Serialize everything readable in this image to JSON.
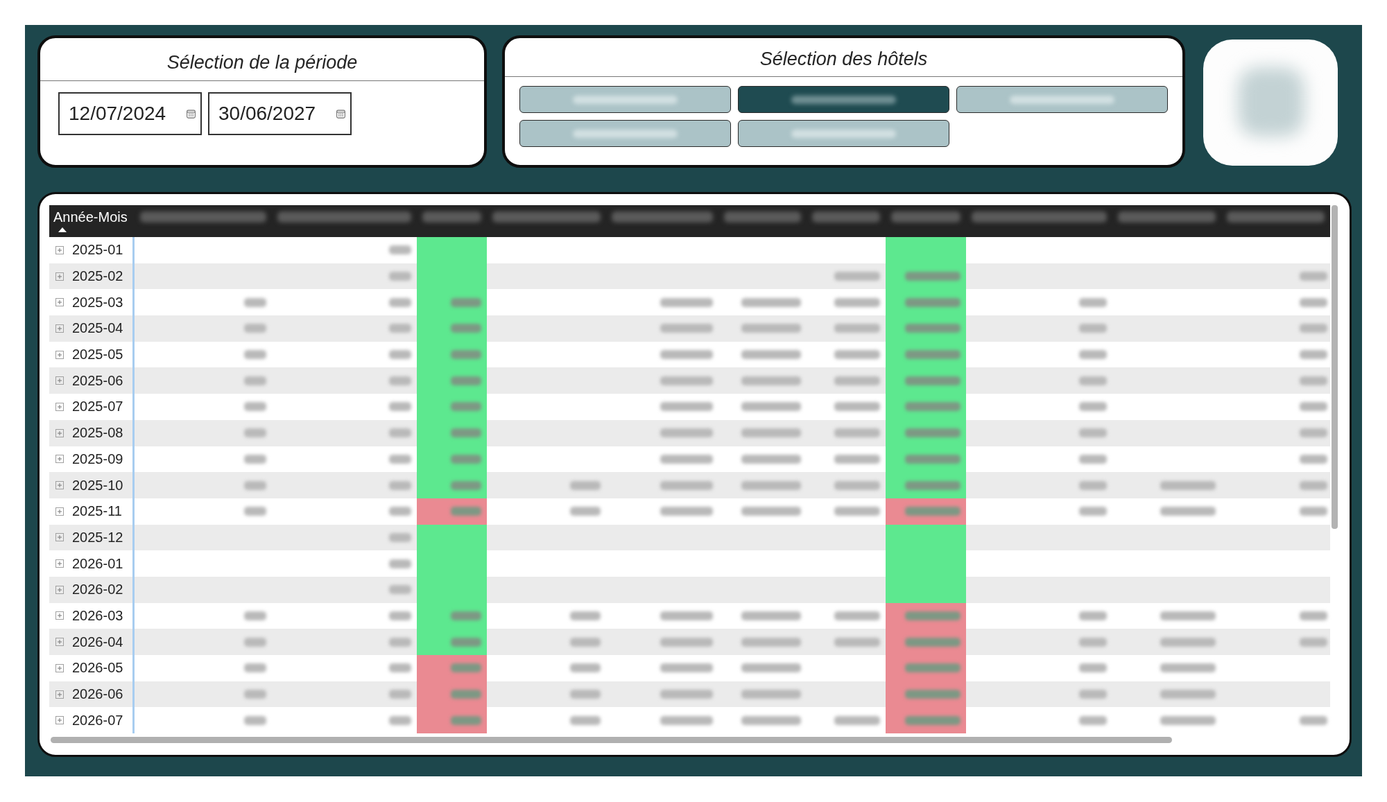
{
  "period": {
    "title": "Sélection de la période",
    "dates": [
      {
        "value": "12/07/2024"
      },
      {
        "value": "30/06/2027"
      }
    ]
  },
  "hotels": {
    "title": "Sélection des hôtels",
    "buttons": [
      {
        "selected": false
      },
      {
        "selected": true
      },
      {
        "selected": false
      },
      {
        "selected": false
      },
      {
        "selected": false
      }
    ]
  },
  "table": {
    "row_header": "Année-Mois",
    "sort_ascending": true,
    "header_cells": [
      {
        "blurred": true
      },
      {
        "blurred": true
      },
      {
        "blurred": true
      },
      {
        "blurred": true
      },
      {
        "blurred": true
      },
      {
        "blurred": true
      },
      {
        "blurred": true
      },
      {
        "blurred": true
      },
      {
        "blurred": true
      },
      {
        "blurred": true
      },
      {
        "blurred": true
      }
    ],
    "rows": [
      {
        "label": "2025-01",
        "expanded": false,
        "cells": [
          {
            "blurred": false
          },
          {
            "blurred": true
          },
          {
            "blurred": false,
            "color": "#5de88f"
          },
          {
            "blurred": false
          },
          {
            "blurred": false
          },
          {
            "blurred": false
          },
          {
            "blurred": false
          },
          {
            "blurred": false,
            "color": "#5de88f"
          },
          {
            "blurred": false
          },
          {
            "blurred": false
          },
          {
            "blurred": false
          }
        ]
      },
      {
        "label": "2025-02",
        "expanded": false,
        "cells": [
          {
            "blurred": false
          },
          {
            "blurred": true
          },
          {
            "blurred": false,
            "color": "#5de88f"
          },
          {
            "blurred": false
          },
          {
            "blurred": false
          },
          {
            "blurred": false
          },
          {
            "blurred": true
          },
          {
            "blurred": true,
            "color": "#5de88f"
          },
          {
            "blurred": false
          },
          {
            "blurred": false
          },
          {
            "blurred": true
          }
        ]
      },
      {
        "label": "2025-03",
        "expanded": false,
        "cells": [
          {
            "blurred": true
          },
          {
            "blurred": true
          },
          {
            "blurred": true,
            "color": "#5de88f"
          },
          {
            "blurred": false
          },
          {
            "blurred": true
          },
          {
            "blurred": true
          },
          {
            "blurred": true
          },
          {
            "blurred": true,
            "color": "#5de88f"
          },
          {
            "blurred": true
          },
          {
            "blurred": false
          },
          {
            "blurred": true
          }
        ]
      },
      {
        "label": "2025-04",
        "expanded": false,
        "cells": [
          {
            "blurred": true
          },
          {
            "blurred": true
          },
          {
            "blurred": true,
            "color": "#5de88f"
          },
          {
            "blurred": false
          },
          {
            "blurred": true
          },
          {
            "blurred": true
          },
          {
            "blurred": true
          },
          {
            "blurred": true,
            "color": "#5de88f"
          },
          {
            "blurred": true
          },
          {
            "blurred": false
          },
          {
            "blurred": true
          }
        ]
      },
      {
        "label": "2025-05",
        "expanded": false,
        "cells": [
          {
            "blurred": true
          },
          {
            "blurred": true
          },
          {
            "blurred": true,
            "color": "#5de88f"
          },
          {
            "blurred": false
          },
          {
            "blurred": true
          },
          {
            "blurred": true
          },
          {
            "blurred": true
          },
          {
            "blurred": true,
            "color": "#5de88f"
          },
          {
            "blurred": true
          },
          {
            "blurred": false
          },
          {
            "blurred": true
          }
        ]
      },
      {
        "label": "2025-06",
        "expanded": false,
        "cells": [
          {
            "blurred": true
          },
          {
            "blurred": true
          },
          {
            "blurred": true,
            "color": "#5de88f"
          },
          {
            "blurred": false
          },
          {
            "blurred": true
          },
          {
            "blurred": true
          },
          {
            "blurred": true
          },
          {
            "blurred": true,
            "color": "#5de88f"
          },
          {
            "blurred": true
          },
          {
            "blurred": false
          },
          {
            "blurred": true
          }
        ]
      },
      {
        "label": "2025-07",
        "expanded": false,
        "cells": [
          {
            "blurred": true
          },
          {
            "blurred": true
          },
          {
            "blurred": true,
            "color": "#5de88f"
          },
          {
            "blurred": false
          },
          {
            "blurred": true
          },
          {
            "blurred": true
          },
          {
            "blurred": true
          },
          {
            "blurred": true,
            "color": "#5de88f"
          },
          {
            "blurred": true
          },
          {
            "blurred": false
          },
          {
            "blurred": true
          }
        ]
      },
      {
        "label": "2025-08",
        "expanded": false,
        "cells": [
          {
            "blurred": true
          },
          {
            "blurred": true
          },
          {
            "blurred": true,
            "color": "#5de88f"
          },
          {
            "blurred": false
          },
          {
            "blurred": true
          },
          {
            "blurred": true
          },
          {
            "blurred": true
          },
          {
            "blurred": true,
            "color": "#5de88f"
          },
          {
            "blurred": true
          },
          {
            "blurred": false
          },
          {
            "blurred": true
          }
        ]
      },
      {
        "label": "2025-09",
        "expanded": false,
        "cells": [
          {
            "blurred": true
          },
          {
            "blurred": true
          },
          {
            "blurred": true,
            "color": "#5de88f"
          },
          {
            "blurred": false
          },
          {
            "blurred": true
          },
          {
            "blurred": true
          },
          {
            "blurred": true
          },
          {
            "blurred": true,
            "color": "#5de88f"
          },
          {
            "blurred": true
          },
          {
            "blurred": false
          },
          {
            "blurred": true
          }
        ]
      },
      {
        "label": "2025-10",
        "expanded": false,
        "cells": [
          {
            "blurred": true
          },
          {
            "blurred": true
          },
          {
            "blurred": true,
            "color": "#5de88f"
          },
          {
            "blurred": true
          },
          {
            "blurred": true
          },
          {
            "blurred": true
          },
          {
            "blurred": true
          },
          {
            "blurred": true,
            "color": "#5de88f"
          },
          {
            "blurred": true
          },
          {
            "blurred": true
          },
          {
            "blurred": true
          }
        ]
      },
      {
        "label": "2025-11",
        "expanded": false,
        "cells": [
          {
            "blurred": true
          },
          {
            "blurred": true
          },
          {
            "blurred": true,
            "color": "#ea8a92"
          },
          {
            "blurred": true
          },
          {
            "blurred": true
          },
          {
            "blurred": true
          },
          {
            "blurred": true
          },
          {
            "blurred": true,
            "color": "#ea8a92"
          },
          {
            "blurred": true
          },
          {
            "blurred": true
          },
          {
            "blurred": true
          }
        ]
      },
      {
        "label": "2025-12",
        "expanded": false,
        "cells": [
          {
            "blurred": false
          },
          {
            "blurred": true
          },
          {
            "blurred": false,
            "color": "#5de88f"
          },
          {
            "blurred": false
          },
          {
            "blurred": false
          },
          {
            "blurred": false
          },
          {
            "blurred": false
          },
          {
            "blurred": false,
            "color": "#5de88f"
          },
          {
            "blurred": false
          },
          {
            "blurred": false
          },
          {
            "blurred": false
          }
        ]
      },
      {
        "label": "2026-01",
        "expanded": false,
        "cells": [
          {
            "blurred": false
          },
          {
            "blurred": true
          },
          {
            "blurred": false,
            "color": "#5de88f"
          },
          {
            "blurred": false
          },
          {
            "blurred": false
          },
          {
            "blurred": false
          },
          {
            "blurred": false
          },
          {
            "blurred": false,
            "color": "#5de88f"
          },
          {
            "blurred": false
          },
          {
            "blurred": false
          },
          {
            "blurred": false
          }
        ]
      },
      {
        "label": "2026-02",
        "expanded": false,
        "cells": [
          {
            "blurred": false
          },
          {
            "blurred": true
          },
          {
            "blurred": false,
            "color": "#5de88f"
          },
          {
            "blurred": false
          },
          {
            "blurred": false
          },
          {
            "blurred": false
          },
          {
            "blurred": false
          },
          {
            "blurred": false,
            "color": "#5de88f"
          },
          {
            "blurred": false
          },
          {
            "blurred": false
          },
          {
            "blurred": false
          }
        ]
      },
      {
        "label": "2026-03",
        "expanded": false,
        "cells": [
          {
            "blurred": true
          },
          {
            "blurred": true
          },
          {
            "blurred": true,
            "color": "#5de88f"
          },
          {
            "blurred": true
          },
          {
            "blurred": true
          },
          {
            "blurred": true
          },
          {
            "blurred": true
          },
          {
            "blurred": true,
            "color": "#ea8a92"
          },
          {
            "blurred": true
          },
          {
            "blurred": true
          },
          {
            "blurred": true
          }
        ]
      },
      {
        "label": "2026-04",
        "expanded": false,
        "cells": [
          {
            "blurred": true
          },
          {
            "blurred": true
          },
          {
            "blurred": true,
            "color": "#5de88f"
          },
          {
            "blurred": true
          },
          {
            "blurred": true
          },
          {
            "blurred": true
          },
          {
            "blurred": true
          },
          {
            "blurred": true,
            "color": "#ea8a92"
          },
          {
            "blurred": true
          },
          {
            "blurred": true
          },
          {
            "blurred": true
          }
        ]
      },
      {
        "label": "2026-05",
        "expanded": false,
        "cells": [
          {
            "blurred": true
          },
          {
            "blurred": true
          },
          {
            "blurred": true,
            "color": "#ea8a92"
          },
          {
            "blurred": true
          },
          {
            "blurred": true
          },
          {
            "blurred": true
          },
          {
            "blurred": false
          },
          {
            "blurred": true,
            "color": "#ea8a92"
          },
          {
            "blurred": true
          },
          {
            "blurred": true
          },
          {
            "blurred": false
          }
        ]
      },
      {
        "label": "2026-06",
        "expanded": false,
        "cells": [
          {
            "blurred": true
          },
          {
            "blurred": true
          },
          {
            "blurred": true,
            "color": "#ea8a92"
          },
          {
            "blurred": true
          },
          {
            "blurred": true
          },
          {
            "blurred": true
          },
          {
            "blurred": false
          },
          {
            "blurred": true,
            "color": "#ea8a92"
          },
          {
            "blurred": true
          },
          {
            "blurred": true
          },
          {
            "blurred": false
          }
        ]
      },
      {
        "label": "2026-07",
        "expanded": false,
        "cells": [
          {
            "blurred": true
          },
          {
            "blurred": true
          },
          {
            "blurred": true,
            "color": "#ea8a92"
          },
          {
            "blurred": true
          },
          {
            "blurred": true
          },
          {
            "blurred": true
          },
          {
            "blurred": true
          },
          {
            "blurred": true,
            "color": "#ea8a92"
          },
          {
            "blurred": true
          },
          {
            "blurred": true
          },
          {
            "blurred": true
          }
        ]
      }
    ]
  }
}
